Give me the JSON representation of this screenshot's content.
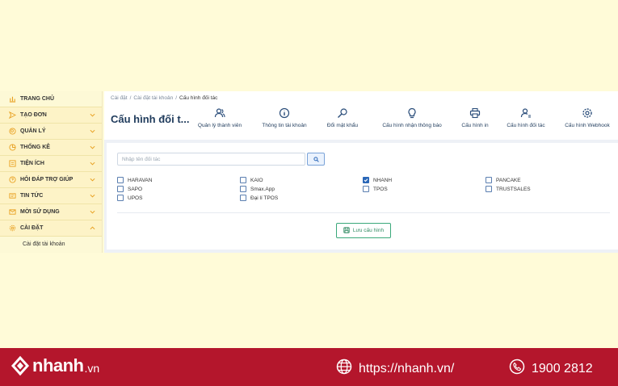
{
  "sidebar": {
    "items": [
      {
        "label": "TRANG CHỦ",
        "icon": "chart-icon"
      },
      {
        "label": "TẠO ĐƠN",
        "icon": "send-icon"
      },
      {
        "label": "QUẢN LÝ",
        "icon": "search-circle-icon"
      },
      {
        "label": "THỐNG KÊ",
        "icon": "pie-chart-icon"
      },
      {
        "label": "TIỆN ÍCH",
        "icon": "list-icon"
      },
      {
        "label": "HỎI ĐÁP TRỢ GIÚP",
        "icon": "help-icon"
      },
      {
        "label": "TIN TỨC",
        "icon": "news-icon"
      },
      {
        "label": "MỜI SỬ DỤNG",
        "icon": "mail-icon"
      },
      {
        "label": "CÀI ĐẶT",
        "icon": "gear-icon"
      }
    ],
    "subitem": "Cài đặt tài khoản"
  },
  "breadcrumb": {
    "a": "Cài đặt",
    "b": "Cài đặt tài khoản",
    "c": "Cấu hình đối tác"
  },
  "page_title": "Cấu hình đối t...",
  "toolbar": [
    {
      "label": "Quản lý thành viên",
      "icon": "users-icon"
    },
    {
      "label": "Thông tin tài khoản",
      "icon": "info-icon"
    },
    {
      "label": "Đổi mật khẩu",
      "icon": "key-icon"
    },
    {
      "label": "Cấu hình nhận thông báo",
      "icon": "bulb-icon"
    },
    {
      "label": "Cấu hình in",
      "icon": "printer-icon"
    },
    {
      "label": "Cấu hình đối tác",
      "icon": "partner-icon"
    },
    {
      "label": "Cấu hình Webhook",
      "icon": "cog-icon"
    }
  ],
  "search": {
    "placeholder": "Nhập tên đối tác"
  },
  "partners": [
    [
      "HARAVAN",
      "SAPO",
      "UPOS"
    ],
    [
      "KAIO",
      "Smax.App",
      "Đại lí TPOS"
    ],
    [
      "NHANH",
      "TPOS"
    ],
    [
      "PANCAKE",
      "TRUSTSALES"
    ]
  ],
  "checked": [
    "NHANH"
  ],
  "save_label": "Lưu cấu hình",
  "footer": {
    "brand": "nhanh",
    "tld": ".vn",
    "url": "https://nhanh.vn/",
    "phone": "1900 2812"
  },
  "colors": {
    "brand_red": "#b4162c",
    "accent": "#e8a020",
    "primary": "#2a67b8",
    "success": "#2f8a62"
  }
}
